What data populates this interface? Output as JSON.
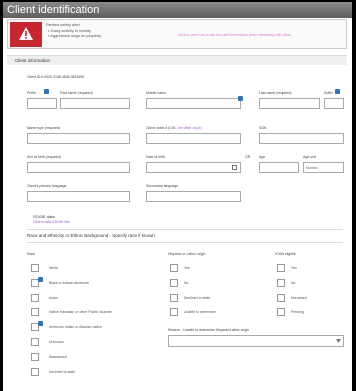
{
  "window": {
    "title": "Client identification"
  },
  "alert": {
    "title": "Review safety alert",
    "lines": [
      "• Gang activity in vicinity",
      "• Aggressive dogs on property"
    ],
    "link": "Click to view how to use this alert information when interacting with client"
  },
  "client_info": {
    "header": "Client information",
    "client_id": "Client ID # 0000 0158 4836 0823450",
    "fields": {
      "prefix": "Prefix",
      "first_name": "First name (required)",
      "middle_name": "Middle name",
      "last_name": "Last name (required)",
      "suffix": "Suffix",
      "name_type": "Name type (required)",
      "client_index": "Client index # (CIN -",
      "client_index_link": "for other org #)",
      "ssn": "SSN",
      "sex_at_birth": "Sex at birth (required)",
      "date_of_birth": "Date of birth",
      "dob_suffix": "OR",
      "age": "Age",
      "age_unit": "Age unit",
      "age_unit_value": "Months",
      "primary_language": "Client's primary language",
      "secondary_language": "Secondary language"
    }
  },
  "sogie": {
    "title": "SOGIE data",
    "link": "Click to add SOGIE info"
  },
  "race": {
    "header": "Race and ethnicity or Ethnic Background - Specify race if known",
    "race_label": "Race",
    "race_options": [
      "White",
      "Black or African American",
      "Asian",
      "Native Hawaiian or other Pacific Islander",
      "American Indian or Alaskan native",
      "Unknown",
      "Abandoned",
      "Declined to state"
    ],
    "hispanic_label": "Hispanic or Latino origin",
    "hispanic_options": [
      "Yes",
      "No",
      "Declined to state",
      "Unable to determine"
    ],
    "icwa_label": "ICWA eligible",
    "icwa_options": [
      "Yes",
      "No",
      "Not asked",
      "Pending"
    ],
    "reason_label": "Reason - Unable to determine Hispanic/Latino origin"
  }
}
